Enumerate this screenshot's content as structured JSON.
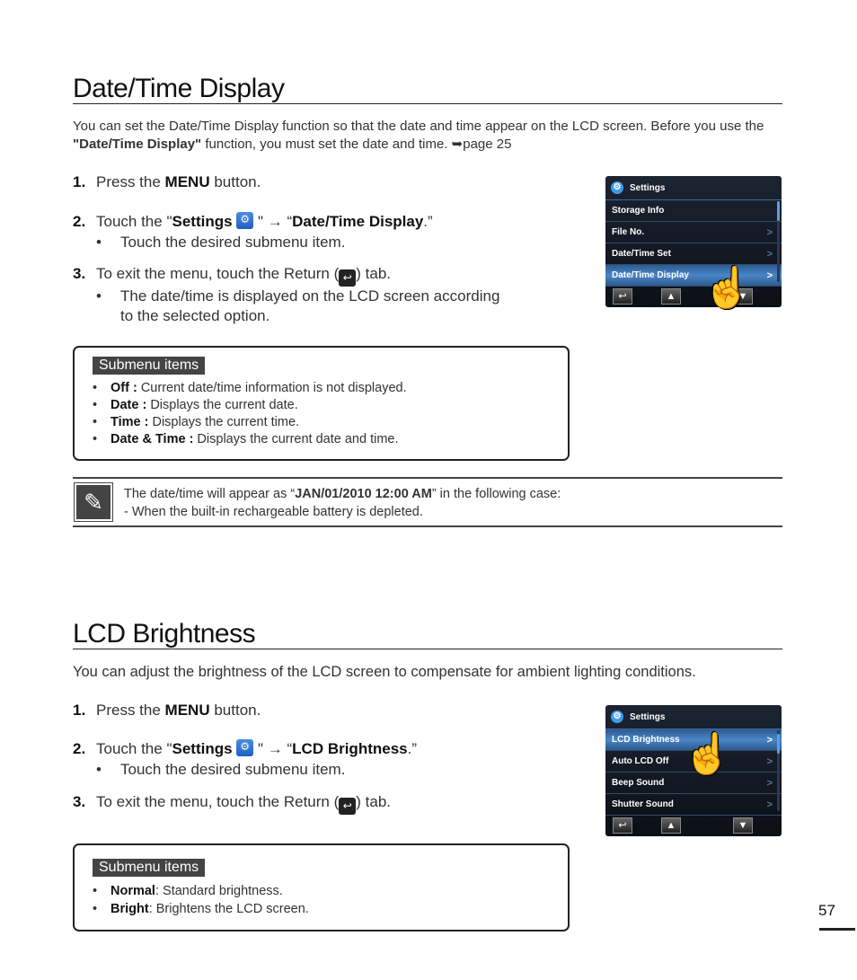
{
  "section1": {
    "title": "Date/Time Display",
    "intro_part1": "You can set the Date/Time Display function so that the date and time appear on the LCD screen. Before you use the ",
    "intro_bold": "\"Date/Time Display\"",
    "intro_part2": " function, you must set the date and time. ",
    "intro_ref": "➥page 25",
    "steps": [
      {
        "num": "1.",
        "pre": "Press the ",
        "bold": "MENU",
        "post": " button."
      },
      {
        "num": "2.",
        "pre": "Touch the \"",
        "bold": "Settings",
        "mid": " \" → “",
        "bold2": "Date/Time Display",
        "post": ".”",
        "sub": "Touch the desired submenu item."
      },
      {
        "num": "3.",
        "pre": "To exit the menu, touch the Return (",
        "post": ") tab.",
        "sub": "The date/time is displayed on the LCD screen according",
        "sub2": "to the selected option."
      }
    ],
    "submenu": {
      "heading": "Submenu items",
      "items": [
        {
          "term": "Off :",
          "desc": " Current date/time information is not displayed."
        },
        {
          "term": "Date :",
          "desc": " Displays the current date."
        },
        {
          "term": "Time :",
          "desc": " Displays the current time."
        },
        {
          "term": "Date & Time :",
          "desc": " Displays the current date and time."
        }
      ]
    },
    "note": {
      "icon": "note-pencil-icon",
      "line1_pre": "The date/time will appear as “",
      "line1_bold": "JAN/01/2010 12:00 AM",
      "line1_post": "” in the following case:",
      "line2": "-   When the built-in rechargeable battery is depleted."
    },
    "lcd": {
      "header": "Settings",
      "rows": [
        {
          "label": "Storage Info",
          "chevron": ""
        },
        {
          "label": "File No.",
          "chevron": ">"
        },
        {
          "label": "Date/Time Set",
          "chevron": ">"
        },
        {
          "label": "Date/Time Display",
          "chevron": ">",
          "selected": true
        }
      ]
    }
  },
  "section2": {
    "title": "LCD Brightness",
    "intro": "You can adjust the brightness of the LCD screen to compensate for ambient lighting conditions.",
    "steps": [
      {
        "num": "1.",
        "pre": "Press the ",
        "bold": "MENU",
        "post": " button."
      },
      {
        "num": "2.",
        "pre": "Touch the \"",
        "bold": "Settings",
        "mid": " \" → “",
        "bold2": "LCD Brightness",
        "post": ".”",
        "sub": "Touch the desired submenu item."
      },
      {
        "num": "3.",
        "pre": "To exit the menu, touch the Return (",
        "post": ") tab."
      }
    ],
    "submenu": {
      "heading": "Submenu items",
      "items": [
        {
          "term": "Normal",
          "desc": ": Standard brightness."
        },
        {
          "term": "Bright",
          "desc": ": Brightens the LCD screen."
        }
      ]
    },
    "lcd": {
      "header": "Settings",
      "rows": [
        {
          "label": "LCD Brightness",
          "chevron": ">",
          "selected": true
        },
        {
          "label": "Auto LCD Off",
          "chevron": ">"
        },
        {
          "label": "Beep Sound",
          "chevron": ">"
        },
        {
          "label": "Shutter Sound",
          "chevron": ">"
        }
      ]
    }
  },
  "page_number": "57"
}
